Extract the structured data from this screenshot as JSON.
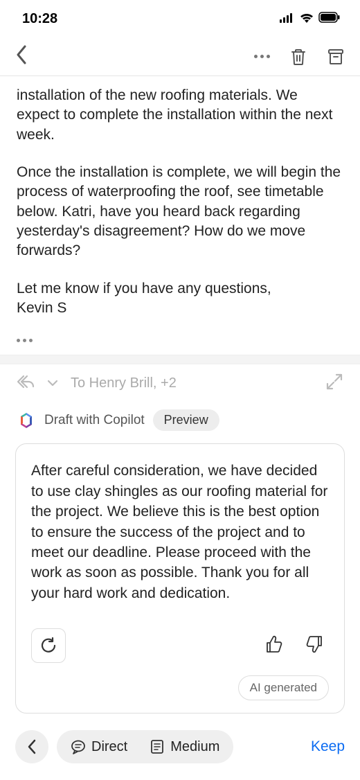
{
  "status": {
    "time": "10:28"
  },
  "email": {
    "body_p1": "installation of the new roofing materials. We expect to complete the installation within the next week.",
    "body_p2": "Once the installation is complete, we will begin the process of waterproofing the roof, see timetable below. Katri, have you heard back regarding yesterday's disagreement? How do we move forwards?",
    "closing": "Let me know if you have any questions,",
    "signature": "Kevin S"
  },
  "reply": {
    "to_line": "To Henry Brill, +2"
  },
  "copilot": {
    "label": "Draft with Copilot",
    "preview_label": "Preview"
  },
  "draft": {
    "text": "After careful consideration, we have decided to use clay shingles as our roofing material for the project. We believe this is the best option to ensure the success of the project and to meet our deadline. Please proceed with the work as soon as possible.  Thank you for all your hard work and dedication.",
    "ai_label": "AI generated"
  },
  "bottom": {
    "direct_label": "Direct",
    "medium_label": "Medium",
    "keep_label": "Keep"
  }
}
